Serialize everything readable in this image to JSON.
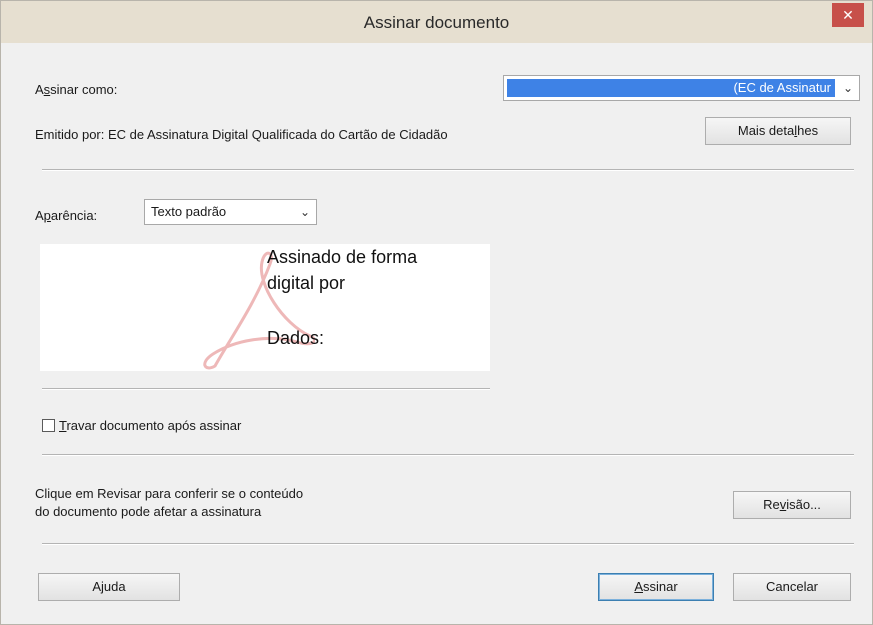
{
  "window": {
    "title": "Assinar documento",
    "close_glyph": "✕"
  },
  "sign_as": {
    "label_pre": "A",
    "label_accel": "s",
    "label_post": "sinar como:",
    "selected_value": "(EC de Assinatur",
    "arrow_glyph": "⌄"
  },
  "issued_by": {
    "text": "Emitido por: EC de Assinatura Digital Qualificada do Cartão de Cidadão"
  },
  "details_button": {
    "label_pre": "Mais deta",
    "label_accel": "l",
    "label_post": "hes"
  },
  "appearance": {
    "label_pre": "A",
    "label_accel": "p",
    "label_post": "arência:",
    "selected_value": "Texto padrão",
    "arrow_glyph": "⌄"
  },
  "preview": {
    "line1": "Assinado de forma",
    "line2": "digital por",
    "line3": "Dados:"
  },
  "lock_document": {
    "label_accel": "T",
    "label_post": "ravar documento após assinar",
    "checked": false
  },
  "review": {
    "line1": "Clique em Revisar para conferir se o conteúdo",
    "line2": "do documento pode afetar a assinatura",
    "button_pre": "Re",
    "button_accel": "v",
    "button_post": "isão..."
  },
  "footer": {
    "help_label": "Ajuda",
    "sign_pre": "",
    "sign_accel": "A",
    "sign_post": "ssinar",
    "cancel_label": "Cancelar"
  },
  "colors": {
    "titlebar": "#e6dfd0",
    "close_button": "#c7504a",
    "selection": "#3e82e6",
    "dialog_bg": "#f0f0f0",
    "adobe_logo": "#e8a0a0"
  }
}
